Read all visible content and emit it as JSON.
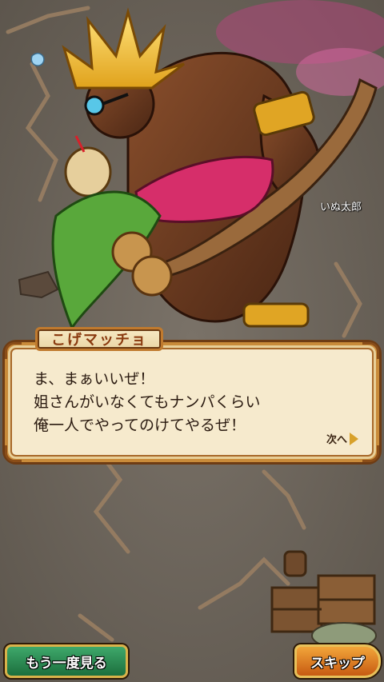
{
  "scene": {
    "player_name": "いぬ太郎"
  },
  "dialog": {
    "speaker": "こげマッチョ",
    "lines": [
      "ま、まぁいいぜ！",
      "姐さんがいなくてもナンパくらい",
      "俺一人でやってのけてやるぜ！"
    ],
    "next_label": "次へ"
  },
  "buttons": {
    "replay_label": "もう一度見る",
    "skip_label": "スキップ"
  },
  "colors": {
    "dialog_bg": "#f6eacd",
    "dialog_border": "#c98b3a",
    "replay_green": "#2e8c55",
    "skip_orange": "#e07a1f"
  }
}
